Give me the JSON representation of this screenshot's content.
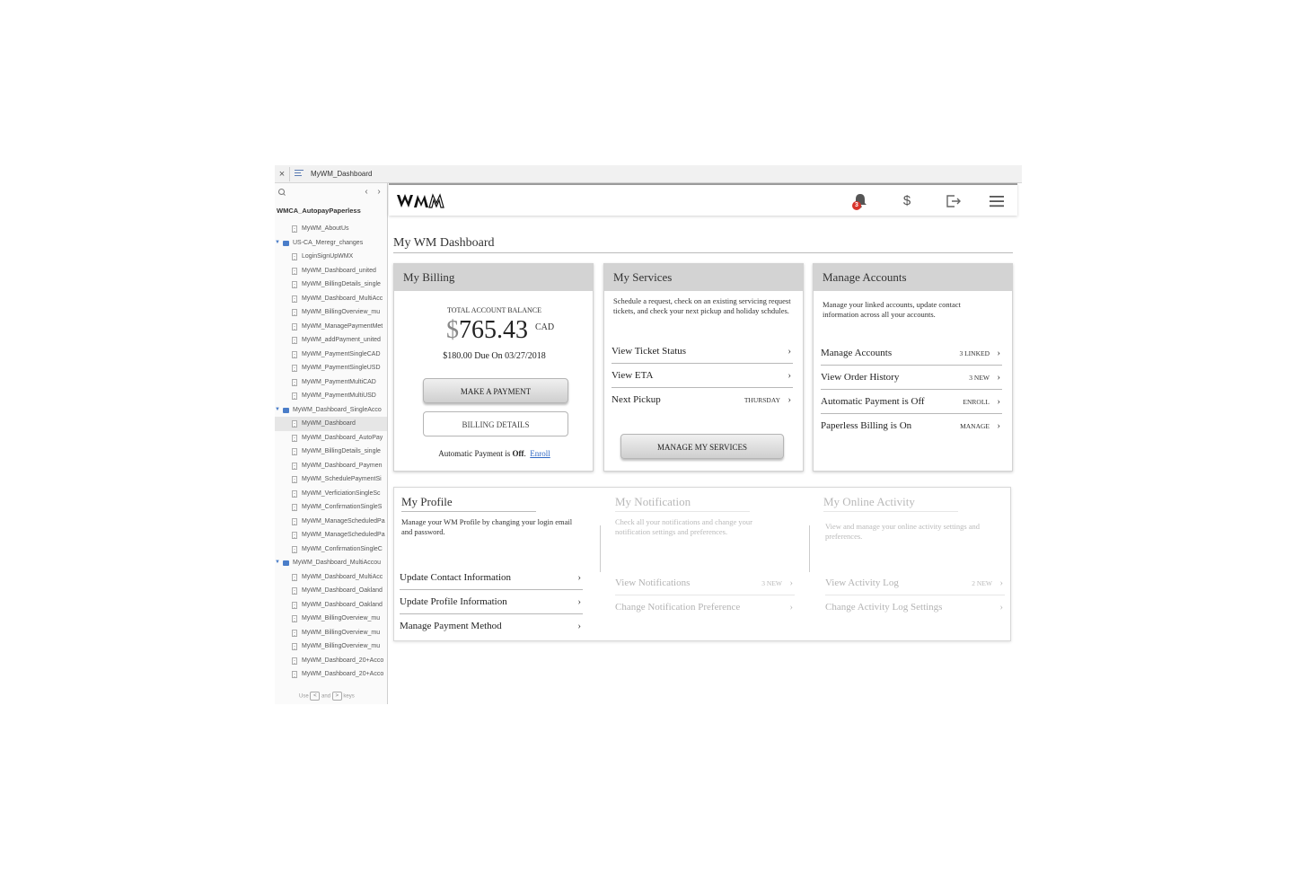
{
  "window": {
    "title": "MyWM_Dashboard",
    "close_glyph": "×"
  },
  "sidebar": {
    "project": "WMCA_AutopayPaperless",
    "hint": {
      "prefix": "Use",
      "key1": "<",
      "and": "and",
      "key2": ">",
      "suffix": "keys"
    },
    "items": [
      {
        "type": "page",
        "label": "MyWM_AboutUs"
      },
      {
        "type": "folder",
        "label": "US-CA_Meregr_changes"
      },
      {
        "type": "page",
        "label": "LoginSignUpWMX"
      },
      {
        "type": "page",
        "label": "MyWM_Dashboard_united"
      },
      {
        "type": "page",
        "label": "MyWM_BillingDetails_single"
      },
      {
        "type": "page",
        "label": "MyWM_Dashboard_MultiAcc"
      },
      {
        "type": "page",
        "label": "MyWM_BillingOverview_mu"
      },
      {
        "type": "page",
        "label": "MyWM_ManagePaymentMet"
      },
      {
        "type": "page",
        "label": "MyWM_addPayment_united"
      },
      {
        "type": "page",
        "label": "MyWM_PaymentSingleCAD"
      },
      {
        "type": "page",
        "label": "MyWM_PaymentSingleUSD"
      },
      {
        "type": "page",
        "label": "MyWM_PaymentMultiCAD"
      },
      {
        "type": "page",
        "label": "MyWM_PaymentMultiUSD"
      },
      {
        "type": "folder",
        "label": "MyWM_Dashboard_SingleAcco"
      },
      {
        "type": "page",
        "label": "MyWM_Dashboard",
        "selected": true
      },
      {
        "type": "page",
        "label": "MyWM_Dashboard_AutoPay"
      },
      {
        "type": "page",
        "label": "MyWM_BillingDetails_single"
      },
      {
        "type": "page",
        "label": "MyWM_Dashboard_Paymen"
      },
      {
        "type": "page",
        "label": "MyWM_SchedulePaymentSi"
      },
      {
        "type": "page",
        "label": "MyWM_VerficiationSingleSc"
      },
      {
        "type": "page",
        "label": "MyWM_ConfirmationSingleS"
      },
      {
        "type": "page",
        "label": "MyWM_ManageScheduledPa"
      },
      {
        "type": "page",
        "label": "MyWM_ManageScheduledPa"
      },
      {
        "type": "page",
        "label": "MyWM_ConfirmationSingleC"
      },
      {
        "type": "folder",
        "label": "MyWM_Dashboard_MultiAccou"
      },
      {
        "type": "page",
        "label": "MyWM_Dashboard_MultiAcc"
      },
      {
        "type": "page",
        "label": "MyWM_Dashboard_Oakland"
      },
      {
        "type": "page",
        "label": "MyWM_Dashboard_Oakland"
      },
      {
        "type": "page",
        "label": "MyWM_BillingOverview_mu"
      },
      {
        "type": "page",
        "label": "MyWM_BillingOverview_mu"
      },
      {
        "type": "page",
        "label": "MyWM_BillingOverview_mu"
      },
      {
        "type": "page",
        "label": "MyWM_Dashboard_20+Acco"
      },
      {
        "type": "page",
        "label": "MyWM_Dashboard_20+Acco"
      }
    ]
  },
  "header": {
    "logo_text": "WM",
    "notification_count": "3",
    "dollar_glyph": "$"
  },
  "page_title": "My WM Dashboard",
  "billing": {
    "title": "My Billing",
    "balance_label": "TOTAL ACCOUNT BALANCE",
    "currency_symbol": "$",
    "balance": "765.43",
    "currency": "CAD",
    "due_amount": "$180.00",
    "due_text": "Due On 03/27/2018",
    "make_payment": "MAKE A PAYMENT",
    "billing_details": "BILLING DETAILS",
    "autopay_prefix": "Automatic Payment is",
    "autopay_state": "Off",
    "enroll": "Enroll"
  },
  "services": {
    "title": "My Services",
    "description": "Schedule a request, check on an existing servicing request tickets, and check your next pickup and holiday schdules.",
    "items": [
      {
        "label": "View Ticket Status",
        "meta": ""
      },
      {
        "label": "View ETA",
        "meta": ""
      },
      {
        "label": "Next Pickup",
        "meta": "THURSDAY"
      }
    ],
    "button": "MANAGE MY SERVICES"
  },
  "manage": {
    "title": "Manage Accounts",
    "description": "Manage your linked accounts, update contact information across all your accounts.",
    "items": [
      {
        "label": "Manage Accounts",
        "meta": "3 LINKED"
      },
      {
        "label": "View Order History",
        "meta": "3 NEW"
      },
      {
        "label": "Automatic Payment is Off",
        "meta": "ENROLL"
      },
      {
        "label": "Paperless Billing is On",
        "meta": "MANAGE"
      }
    ]
  },
  "profile": {
    "title": "My Profile",
    "description": "Manage your WM Profile by changing your login email and password.",
    "items": [
      {
        "label": "Update Contact Information"
      },
      {
        "label": "Update Profile Information"
      },
      {
        "label": "Manage Payment Method"
      }
    ]
  },
  "notification": {
    "title": "My Notification",
    "description": "Check all your notifications and change your notification settings and preferences.",
    "items": [
      {
        "label": "View Notifications",
        "meta": "3 NEW"
      },
      {
        "label": "Change Notification Preference",
        "meta": ""
      }
    ]
  },
  "activity": {
    "title": "My Online Activity",
    "description": "View and manage your online activity settings and preferences.",
    "items": [
      {
        "label": "View Activity Log",
        "meta": "2 NEW"
      },
      {
        "label": "Change Activity Log Settings",
        "meta": ""
      }
    ]
  },
  "icons": {
    "chevron": "›",
    "prev": "‹",
    "next": "›",
    "expanded": "▼"
  },
  "colors": {
    "link": "#2d67c4",
    "badge": "#d9342b",
    "folder": "#4a7dc9",
    "card_header": "#d3d3d3"
  }
}
